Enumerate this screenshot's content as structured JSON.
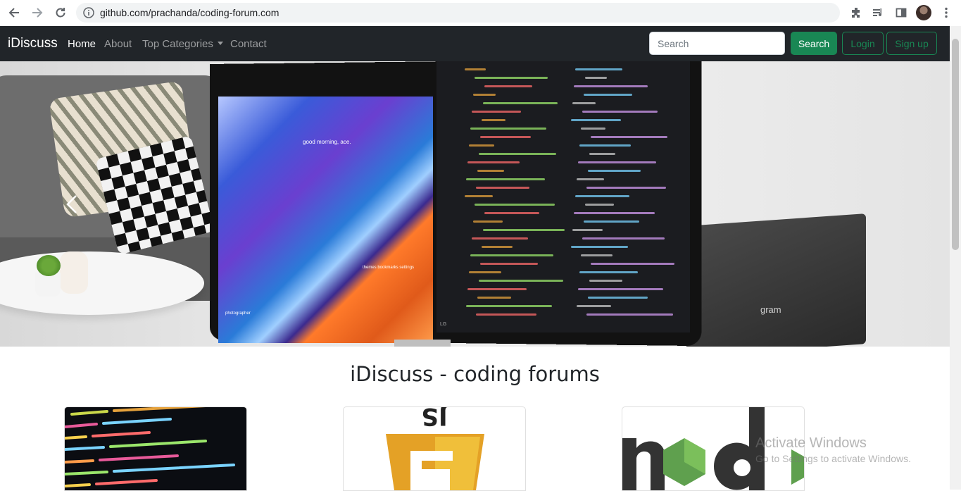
{
  "browser": {
    "url": "github.com/prachanda/coding-forum.com",
    "icons": [
      "back-arrow-icon",
      "forward-arrow-icon",
      "reload-icon",
      "site-info-icon",
      "extensions-icon",
      "media-queue-icon",
      "side-panel-icon",
      "profile-avatar",
      "more-menu-icon"
    ]
  },
  "navbar": {
    "brand": "iDiscuss",
    "links": [
      {
        "label": "Home",
        "active": true
      },
      {
        "label": "About"
      },
      {
        "label": "Top Categories",
        "dropdown": true
      },
      {
        "label": "Contact"
      }
    ],
    "search_placeholder": "Search",
    "search_button": "Search",
    "login_button": "Login",
    "signup_button": "Sign up",
    "colors": {
      "background": "#212529",
      "success": "#198754"
    }
  },
  "carousel": {
    "prev_icon": "chevron-left-icon",
    "scene": {
      "screen_greeting": "good morning, ace.",
      "screen_tags": "themes  bookmarks  settings",
      "screen_caption": "photographer",
      "laptop_brand": "gram",
      "monitor_brand": "LG"
    }
  },
  "main": {
    "heading": "iDiscuss - coding forums"
  },
  "categories": [
    {
      "name": "code-editor-screenshot"
    },
    {
      "name": "javascript-logo",
      "logo_text": "JS"
    },
    {
      "name": "nodejs-logo"
    }
  ],
  "watermark": {
    "title": "Activate Windows",
    "subtitle": "Go to Settings to activate Windows."
  }
}
